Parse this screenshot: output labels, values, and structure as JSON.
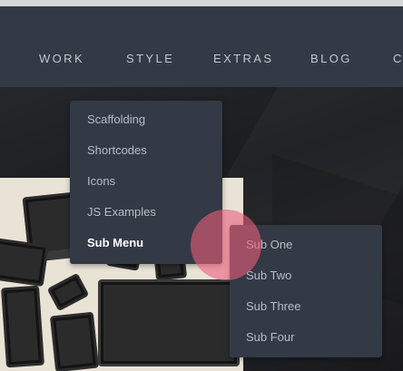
{
  "nav": {
    "items": [
      "WORK",
      "STYLE",
      "EXTRAS",
      "BLOG",
      "C"
    ]
  },
  "dropdown": {
    "items": [
      "Scaffolding",
      "Shortcodes",
      "Icons",
      "JS Examples",
      "Sub Menu"
    ],
    "active": "Sub Menu"
  },
  "submenu": {
    "items": [
      "Sub One",
      "Sub Two",
      "Sub Three",
      "Sub Four"
    ]
  },
  "colors": {
    "navbar": "#333945",
    "menu_bg": "#333945",
    "menu_text": "#b9bdc6",
    "cursor_highlight": "#e95f7c"
  }
}
